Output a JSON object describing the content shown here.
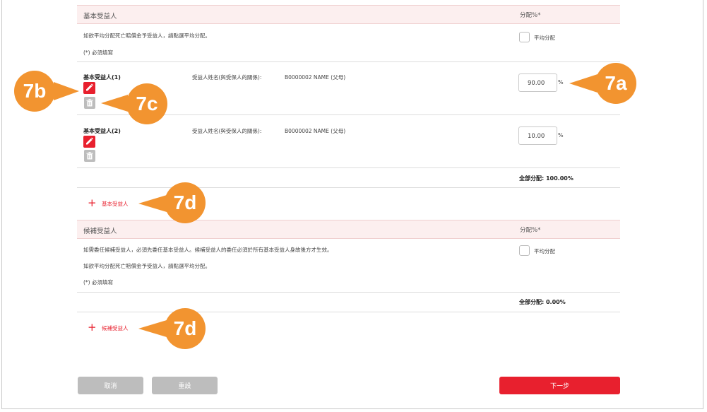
{
  "colors": {
    "accent": "#e8202e",
    "callout": "#f29430",
    "header_bg": "#fcefef",
    "grey_button": "#bdbdbd"
  },
  "basic_section": {
    "title": "基本受益人",
    "pct_header": "分配%*",
    "instruction": "如欲平均分配死亡賠償金予受益人，請點選平均分配。",
    "required_note": "(*) 必須填寫",
    "equal_split_label": "平均分配",
    "beneficiaries": [
      {
        "label": "基本受益人(1)",
        "name_label": "受益人姓名(與受保人的關係):",
        "name_value": "B0000002 NAME (父母)",
        "percent": "90.00",
        "edit_icon": "pencil-icon",
        "delete_icon": "trash-icon"
      },
      {
        "label": "基本受益人(2)",
        "name_label": "受益人姓名(與受保人的關係):",
        "name_value": "B0000002 NAME (父母)",
        "percent": "10.00",
        "edit_icon": "pencil-icon",
        "delete_icon": "trash-icon"
      }
    ],
    "percent_sign": "%",
    "total": "全部分配: 100.00%",
    "add_label": "基本受益人"
  },
  "contingent_section": {
    "title": "候補受益人",
    "pct_header": "分配%*",
    "instruction1": "如需委任候補受益人，必須先委任基本受益人。候補受益人的委任必須於所有基本受益人身故後方才生效。",
    "instruction2": "如欲平均分配死亡賠償金予受益人，請點選平均分配。",
    "required_note": "(*) 必須填寫",
    "equal_split_label": "平均分配",
    "total": "全部分配: 0.00%",
    "add_label": "候補受益人"
  },
  "buttons": {
    "cancel": "取消",
    "reset": "重設",
    "next": "下一步"
  },
  "callouts": {
    "a": "7a",
    "b": "7b",
    "c": "7c",
    "d1": "7d",
    "d2": "7d"
  }
}
